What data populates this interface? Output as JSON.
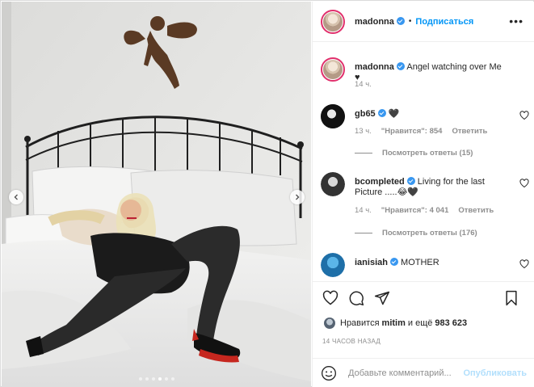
{
  "post": {
    "username": "madonna",
    "bullet": "•",
    "follow_label": "Подписаться",
    "more_icon": "more-horizontal-icon",
    "caption": {
      "username": "madonna",
      "text": "Angel watching over Me ♥",
      "time": "14 ч."
    },
    "carousel": {
      "slide_count": 6,
      "active_index": 3
    }
  },
  "comments": [
    {
      "username": "gb65",
      "verified": true,
      "text": "🖤",
      "time": "13 ч.",
      "likes": "\"Нравится\": 854",
      "reply_label": "Ответить",
      "view_replies": "Посмотреть ответы (15)"
    },
    {
      "username": "bcompleted",
      "verified": true,
      "text": "Living for the last Picture .....😂🖤",
      "time": "14 ч.",
      "likes": "\"Нравится\": 4 041",
      "reply_label": "Ответить",
      "view_replies": "Посмотреть ответы (176)"
    },
    {
      "username": "ianisiah",
      "verified": true,
      "text": "MOTHER"
    }
  ],
  "actions": {
    "like_icon": "heart-icon",
    "comment_icon": "comment-icon",
    "share_icon": "share-icon",
    "save_icon": "bookmark-icon"
  },
  "likes": {
    "prefix": "Нравится",
    "user": "mitim",
    "suffix": "и ещё",
    "count": "983 623"
  },
  "timestamp": "14 ЧАСОВ НАЗАД",
  "add_comment": {
    "placeholder": "Добавьте комментарий...",
    "post_label": "Опубликовать"
  },
  "colors": {
    "link_blue": "#0095f6",
    "verified_blue": "#3897f0",
    "muted": "#8e8e8e",
    "post_disabled": "#b2dffc"
  }
}
